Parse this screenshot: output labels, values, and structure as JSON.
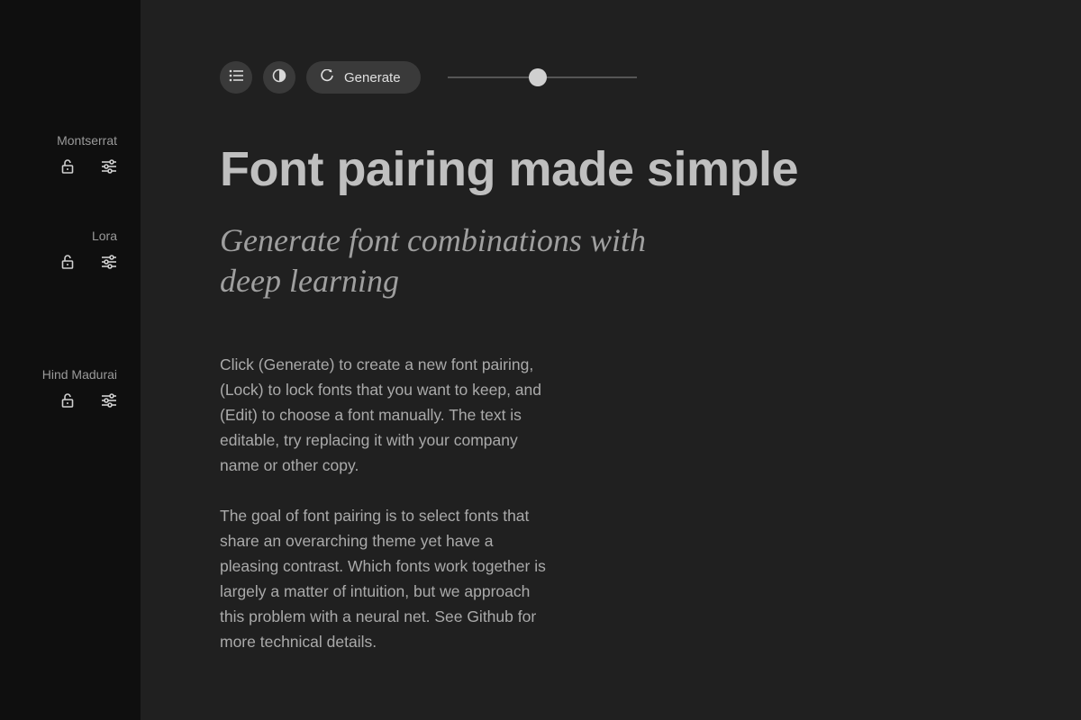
{
  "sidebar": {
    "fonts": [
      {
        "name": "Montserrat"
      },
      {
        "name": "Lora"
      },
      {
        "name": "Hind Madurai"
      }
    ]
  },
  "toolbar": {
    "generate_label": "Generate"
  },
  "content": {
    "headline": "Font pairing made simple",
    "subhead": "Generate font combinations with deep learning",
    "body": [
      "Click (Generate) to create a new font pairing, (Lock) to lock fonts that you want to keep, and (Edit) to choose a font manually. The text is editable, try replacing it with your company name or other copy.",
      "The goal of font pairing is to select fonts that share an overarching theme yet have a pleasing contrast. Which fonts work together is largely a matter of intuition, but we approach this problem with a neural net. See Github for more technical details."
    ]
  }
}
